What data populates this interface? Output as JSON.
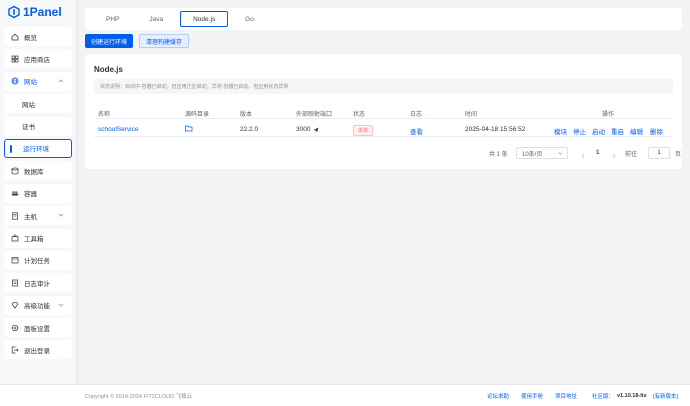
{
  "app": {
    "name": "1Panel"
  },
  "sidebar": {
    "items": [
      {
        "label": "概览",
        "icon": "home-icon"
      },
      {
        "label": "应用商店",
        "icon": "store-icon"
      },
      {
        "label": "网站",
        "icon": "globe-icon"
      },
      {
        "label": "网站",
        "icon": ""
      },
      {
        "label": "证书",
        "icon": ""
      },
      {
        "label": "运行环境",
        "icon": ""
      },
      {
        "label": "数据库",
        "icon": "database-icon"
      },
      {
        "label": "容器",
        "icon": "container-icon"
      },
      {
        "label": "主机",
        "icon": "host-icon"
      },
      {
        "label": "工具箱",
        "icon": "toolbox-icon"
      },
      {
        "label": "计划任务",
        "icon": "calendar-icon"
      },
      {
        "label": "日志审计",
        "icon": "log-icon"
      },
      {
        "label": "高级功能",
        "icon": "diamond-icon"
      },
      {
        "label": "面板设置",
        "icon": "settings-icon"
      },
      {
        "label": "退出登录",
        "icon": "logout-icon"
      }
    ]
  },
  "tabs": [
    "PHP",
    "Java",
    "Node.js",
    "Go"
  ],
  "actions": {
    "create": "创建运行环境",
    "clear_cache": "清理构建缓存"
  },
  "card": {
    "title": "Node.js",
    "notice": "状态说明：启动中-容器已启动，但应用正在启动；异常-容器已启动，但应用状态异常"
  },
  "table": {
    "headers": [
      "名称",
      "源码目录",
      "版本",
      "外部映射端口",
      "状态",
      "日志",
      "时间",
      "操作"
    ],
    "row": {
      "name": "schoolService",
      "version": "22.2.0",
      "port": "3000",
      "status": "失败",
      "log": "查看",
      "time": "2025-04-18 15:56:52",
      "ops": [
        "模块",
        "停止",
        "启动",
        "重启",
        "编辑",
        "删除"
      ]
    }
  },
  "pagination": {
    "total": "共 1 条",
    "page_size": "10条/页",
    "current": "1",
    "goto": "前往",
    "goto_value": "1",
    "page_unit": "页"
  },
  "footer": {
    "copyright": "Copyright © 2014-2024 FIT2CLOUD 飞致云",
    "forum": "论坛求助",
    "manual": "使用手册",
    "project": "项目地址",
    "edition": "社区版：",
    "version": "v1.10.18-lts",
    "update": "[有新版本]"
  },
  "colors": {
    "primary": "#005eeb",
    "danger": "#f56c6c"
  }
}
